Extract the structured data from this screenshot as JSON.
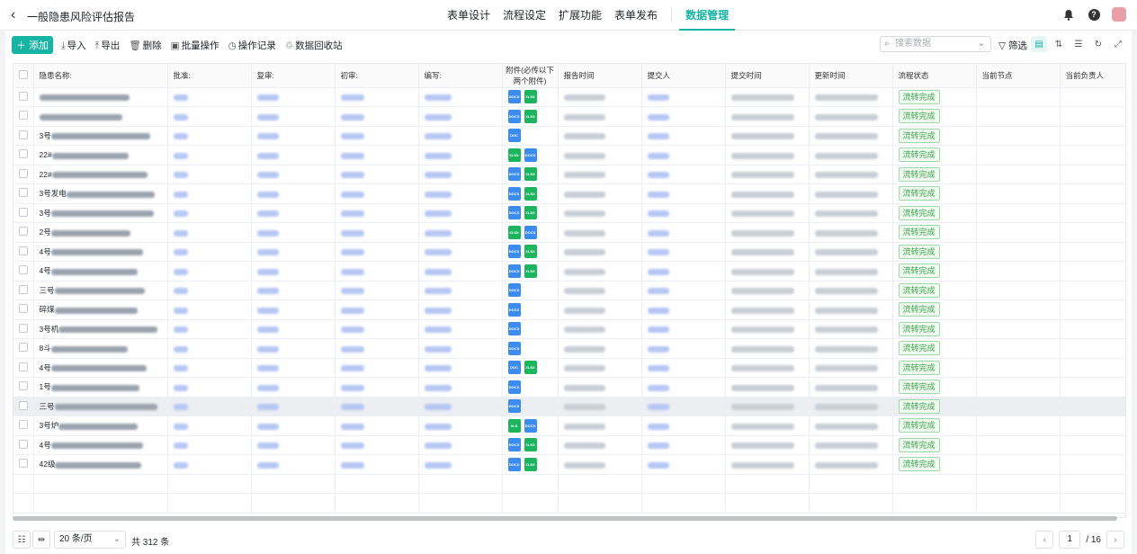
{
  "header": {
    "title": "一般隐患风险评估报告",
    "tabs": [
      "表单设计",
      "流程设定",
      "扩展功能",
      "表单发布"
    ],
    "active_tab": "数据管理"
  },
  "toolbar": {
    "add_label": "添加",
    "actions": [
      "导入",
      "导出",
      "删除",
      "批量操作",
      "操作记录",
      "数据回收站"
    ],
    "search_placeholder": "搜索数据",
    "filter_label": "筛选"
  },
  "columns": [
    "隐患名称:",
    "批准:",
    "复审:",
    "初审:",
    "编写:",
    "附件(必传以下两个附件)",
    "报告时间",
    "提交人",
    "提交时间",
    "更新时间",
    "流程状态",
    "当前节点",
    "当前负责人"
  ],
  "rows": [
    {
      "name": "",
      "attachments": [
        "DOCX",
        "XLSX"
      ],
      "status": "流转完成"
    },
    {
      "name": "",
      "attachments": [
        "DOCX",
        "XLSX"
      ],
      "status": "流转完成"
    },
    {
      "name": "3号",
      "attachments": [
        "DOC"
      ],
      "status": "流转完成"
    },
    {
      "name": "22#",
      "attachments": [
        "XLSX",
        "DOCX"
      ],
      "status": "流转完成"
    },
    {
      "name": "22#",
      "attachments": [
        "DOCX",
        "XLSX"
      ],
      "status": "流转完成"
    },
    {
      "name": "3号发电",
      "attachments": [
        "DOCX",
        "XLSX"
      ],
      "status": "流转完成"
    },
    {
      "name": "3号",
      "attachments": [
        "DOCX",
        "XLSX"
      ],
      "status": "流转完成"
    },
    {
      "name": "2号",
      "attachments": [
        "XLSX",
        "DOCX"
      ],
      "status": "流转完成"
    },
    {
      "name": "4号",
      "attachments": [
        "DOCX",
        "XLSX"
      ],
      "status": "流转完成"
    },
    {
      "name": "4号",
      "attachments": [
        "DOCX",
        "XLSX"
      ],
      "status": "流转完成"
    },
    {
      "name": "三号",
      "attachments": [
        "DOCX"
      ],
      "status": "流转完成"
    },
    {
      "name": "碎煤",
      "attachments": [
        "DOCX"
      ],
      "status": "流转完成"
    },
    {
      "name": "3号机",
      "attachments": [
        "DOCX"
      ],
      "status": "流转完成"
    },
    {
      "name": "8斗",
      "attachments": [
        "DOCX"
      ],
      "status": "流转完成"
    },
    {
      "name": "4号",
      "attachments": [
        "DOC",
        "XLSX"
      ],
      "status": "流转完成"
    },
    {
      "name": "1号",
      "attachments": [
        "DOCX"
      ],
      "status": "流转完成"
    },
    {
      "name": "三号",
      "attachments": [
        "DOCX"
      ],
      "status": "流转完成"
    },
    {
      "name": "3号炉",
      "attachments": [
        "XLS",
        "DOCX"
      ],
      "status": "流转完成"
    },
    {
      "name": "4号",
      "attachments": [
        "DOCX",
        "XLSX"
      ],
      "status": "流转完成"
    },
    {
      "name": "42级",
      "attachments": [
        "DOCX",
        "XLSX"
      ],
      "status": "流转完成"
    }
  ],
  "footer": {
    "page_size": "20 条/页",
    "total": "共 312 条",
    "current_page": "1",
    "total_pages": "/ 16"
  }
}
